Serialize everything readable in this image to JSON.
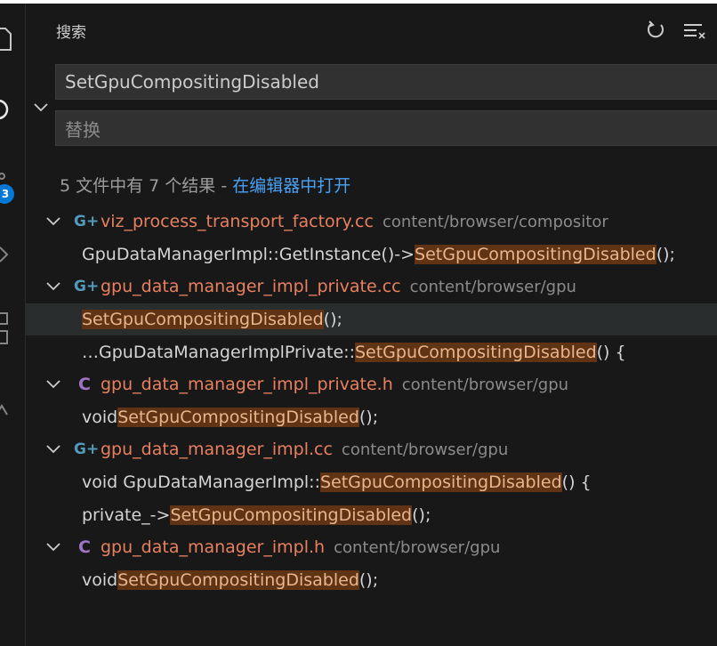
{
  "search": {
    "title": "搜索",
    "query": "SetGpuCompositingDisabled",
    "replace_placeholder": "替换",
    "summary": "5 文件中有 7 个结果 - ",
    "open_in_editor": "在编辑器中打开"
  },
  "activity_bar": {
    "badge": "3"
  },
  "results": [
    {
      "file": "viz_process_transport_factory.cc",
      "path": "content/browser/compositor",
      "icon": "cpp-file-icon",
      "matches": [
        {
          "before": "GpuDataManagerImpl::GetInstance()->",
          "match": "SetGpuCompositingDisabled",
          "after": "();"
        }
      ]
    },
    {
      "file": "gpu_data_manager_impl_private.cc",
      "path": "content/browser/gpu",
      "icon": "cpp-file-icon",
      "matches": [
        {
          "before": "",
          "match": "SetGpuCompositingDisabled",
          "after": "();"
        },
        {
          "before": "…GpuDataManagerImplPrivate::",
          "match": "SetGpuCompositingDisabled",
          "after": "() {"
        }
      ]
    },
    {
      "file": "gpu_data_manager_impl_private.h",
      "path": "content/browser/gpu",
      "icon": "c-header-file-icon",
      "matches": [
        {
          "before": "void ",
          "match": "SetGpuCompositingDisabled",
          "after": "();"
        }
      ]
    },
    {
      "file": "gpu_data_manager_impl.cc",
      "path": "content/browser/gpu",
      "icon": "cpp-file-icon",
      "matches": [
        {
          "before": "void GpuDataManagerImpl::",
          "match": "SetGpuCompositingDisabled",
          "after": "() {"
        },
        {
          "before": "private_->",
          "match": "SetGpuCompositingDisabled",
          "after": "();"
        }
      ]
    },
    {
      "file": "gpu_data_manager_impl.h",
      "path": "content/browser/gpu",
      "icon": "c-header-file-icon",
      "matches": [
        {
          "before": "void ",
          "match": "SetGpuCompositingDisabled",
          "after": "();"
        }
      ]
    }
  ]
}
